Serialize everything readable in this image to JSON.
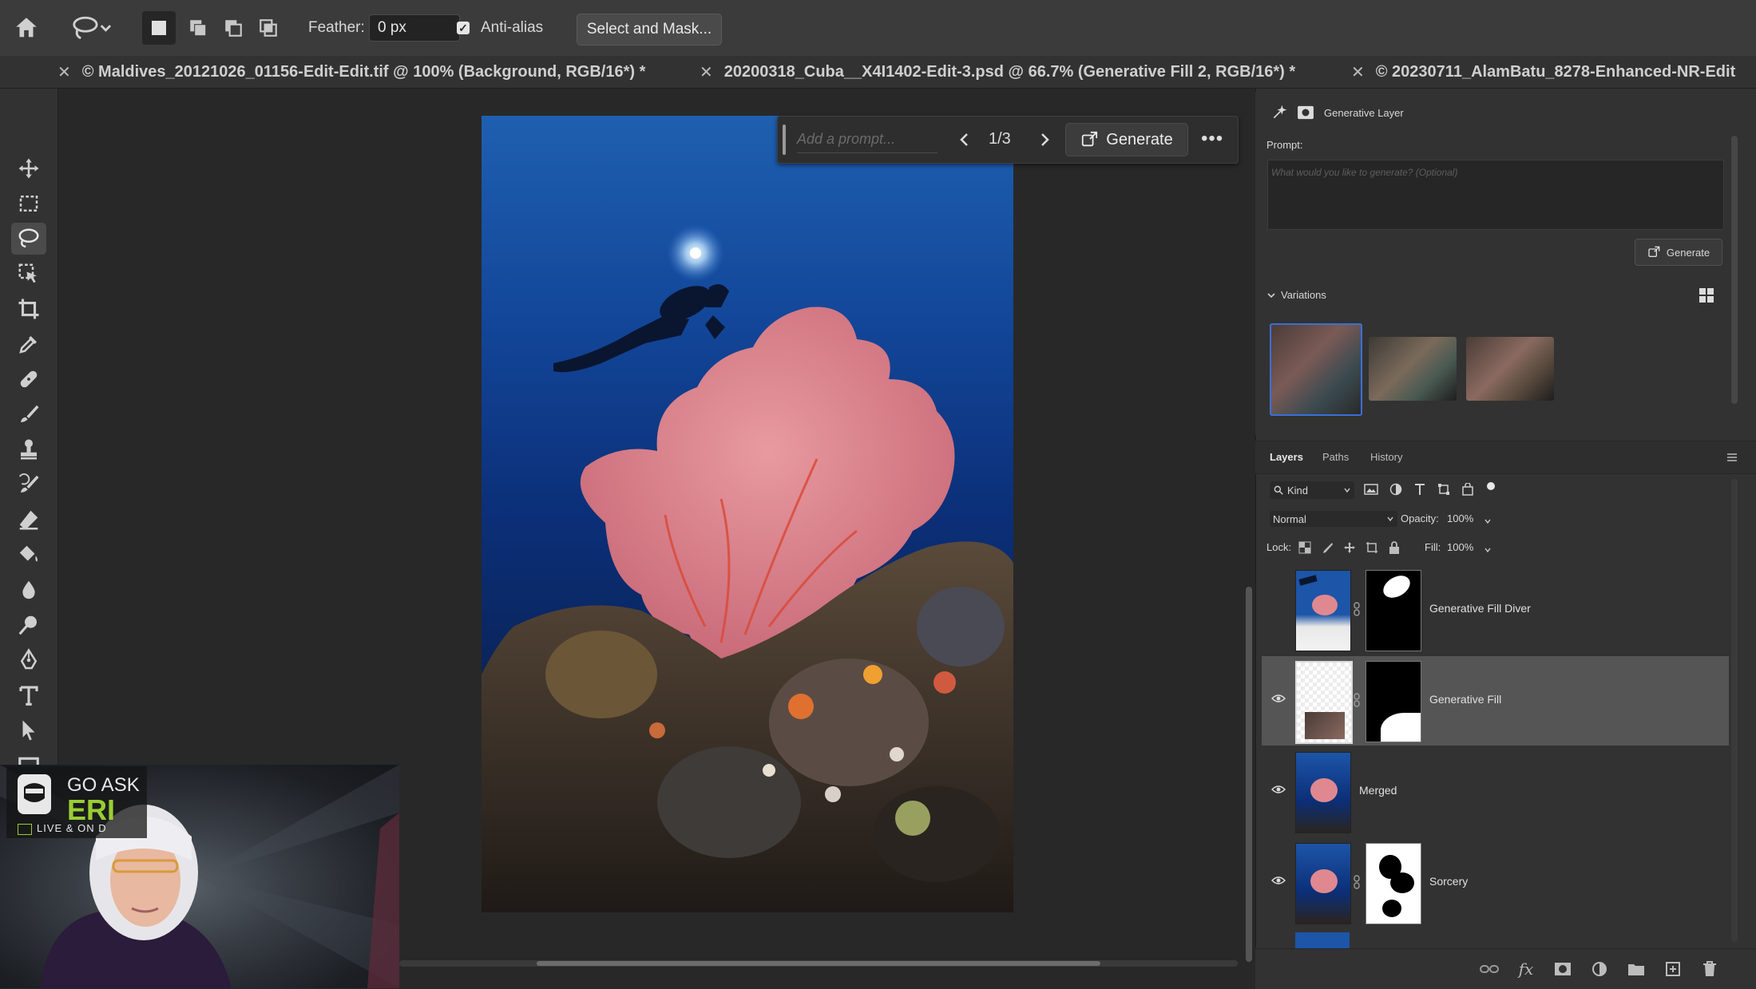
{
  "options_bar": {
    "feather_label": "Feather:",
    "feather_value": "0 px",
    "antialias_label": "Anti-alias",
    "antialias_checked": true,
    "select_mask_label": "Select and Mask..."
  },
  "tabs": [
    {
      "label": "© Maldives_20121026_01156-Edit-Edit.tif @ 100% (Background, RGB/16*) *"
    },
    {
      "label": "20200318_Cuba__X4I1402-Edit-3.psd @ 66.7% (Generative Fill 2, RGB/16*) *"
    },
    {
      "label": "© 20230711_AlamBatu_8278-Enhanced-NR-Edit"
    }
  ],
  "context_bar": {
    "prompt_placeholder": "Add a prompt...",
    "counter": "1/3",
    "generate_label": "Generate"
  },
  "properties": {
    "title": "Generative Layer",
    "prompt_label": "Prompt:",
    "prompt_placeholder": "What would you like to generate? (Optional)",
    "generate_label": "Generate",
    "variations_label": "Variations"
  },
  "layers_panel": {
    "tabs": [
      "Layers",
      "Paths",
      "History"
    ],
    "kind_label": "Kind",
    "blend_mode": "Normal",
    "opacity_label": "Opacity:",
    "opacity_value": "100%",
    "lock_label": "Lock:",
    "fill_label": "Fill:",
    "fill_value": "100%",
    "layers": [
      {
        "name": "Generative Fill  Diver",
        "visible": false,
        "selected": false
      },
      {
        "name": "Generative Fill",
        "visible": true,
        "selected": true
      },
      {
        "name": "Merged",
        "visible": true,
        "selected": false
      },
      {
        "name": "Sorcery",
        "visible": true,
        "selected": false
      }
    ]
  },
  "webcam": {
    "logo_line1": "GO ASK",
    "logo_line2": "ERI",
    "logo_line3": "LIVE & ON D"
  },
  "colors": {
    "accent_blue": "#3b6fd6",
    "panel_bg": "#323232",
    "canvas_bg": "#282828",
    "logo_green": "#9acd32"
  }
}
